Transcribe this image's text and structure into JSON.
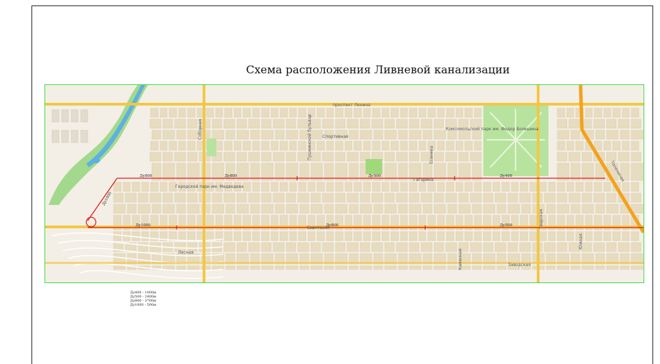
{
  "title": "Схема расположения Ливневой канализации",
  "colors": {
    "frame_border": "#3fdc3f",
    "pipe_main": "#e01818",
    "road_yellow": "#f2c744",
    "road_orange": "#f4a21c",
    "block": "#e8dcc0",
    "park": "#9fd97a",
    "water": "#5fb0e0"
  },
  "streets": {
    "lenin": "проспект Ленина",
    "sportivnaya": "Спортивная",
    "sobornaya": "Соборная",
    "pushkinsky": "Пушкинский бульвар",
    "gagarina": "Гагарина",
    "sovetskaya": "Советская",
    "kamennaya": "Каменная",
    "lesnaya": "Лесная",
    "zavodskaya": "Заводская",
    "yuzhnaya": "Южная",
    "tverskaya": "Тверская",
    "medvedev_park": "Городской парк им. Медведева",
    "komsomolsky_park": "Комсомольский парк им. Федор Болешина",
    "topolinaya": "Тополиная",
    "yeseninа": "Есенина"
  },
  "pipe_labels": {
    "d800_a": "Ду800",
    "d800_b": "Ду800",
    "d500_a": "Ду500",
    "d400_a": "Ду400",
    "d1000_diag": "Ду1000",
    "d1000_a": "Ду1000",
    "d800_c": "Ду800",
    "d500_b": "Ду500"
  },
  "legend": [
    "Ду400 - 1000м",
    "Ду500 - 2400м",
    "Ду800 - 3700м",
    "Ду1000 - 500м"
  ]
}
